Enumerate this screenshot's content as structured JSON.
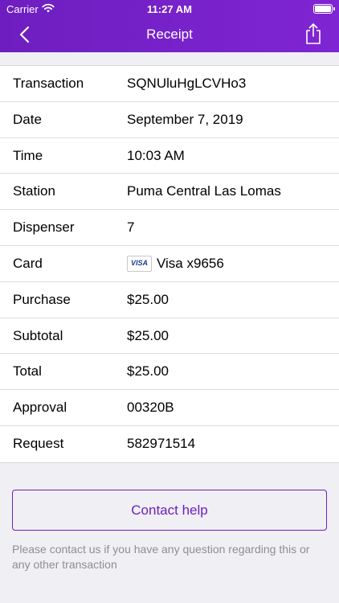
{
  "status_bar": {
    "carrier": "Carrier",
    "time": "11:27 AM"
  },
  "nav": {
    "title": "Receipt",
    "back_icon": "chevron-left-icon",
    "share_icon": "share-icon"
  },
  "colors": {
    "header_bg": "#6e1ec0",
    "accent": "#6e1ec0",
    "page_bg": "#efeff4"
  },
  "receipt": {
    "rows": [
      {
        "label": "Transaction",
        "value": "SQNUluHgLCVHo3"
      },
      {
        "label": "Date",
        "value": "September 7, 2019"
      },
      {
        "label": "Time",
        "value": "10:03 AM"
      },
      {
        "label": "Station",
        "value": "Puma Central Las Lomas"
      },
      {
        "label": "Dispenser",
        "value": "7"
      },
      {
        "label": "Card",
        "value": "Visa x9656",
        "card_brand": "VISA"
      },
      {
        "label": "Purchase",
        "value": "$25.00"
      },
      {
        "label": "Subtotal",
        "value": "$25.00"
      },
      {
        "label": "Total",
        "value": "$25.00"
      },
      {
        "label": "Approval",
        "value": "00320B"
      },
      {
        "label": "Request",
        "value": "582971514"
      }
    ]
  },
  "help": {
    "button_label": "Contact help",
    "note": "Please contact us if you have any question regarding this or any other transaction"
  }
}
